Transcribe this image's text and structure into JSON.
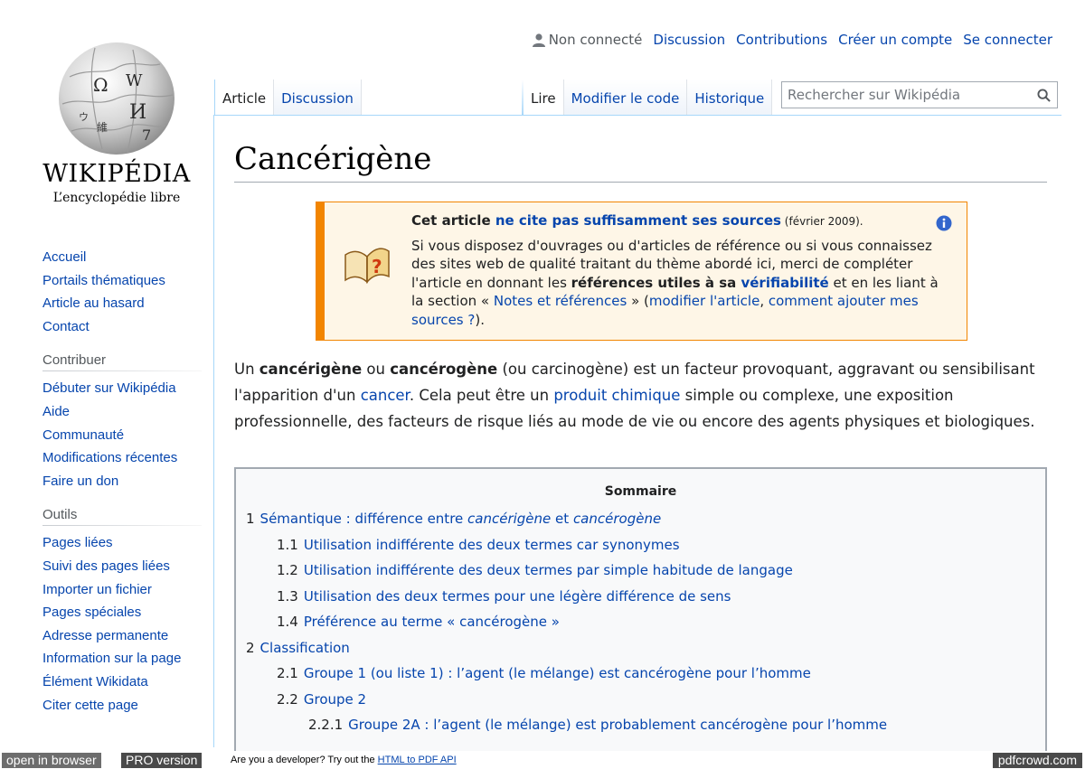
{
  "personal": {
    "status": "Non connecté",
    "links": [
      "Discussion",
      "Contributions",
      "Créer un compte",
      "Se connecter"
    ]
  },
  "logo": {
    "wordmark": "WIKIPÉDIA",
    "tagline": "L’encyclopédie libre",
    "globe_icon": "wikipedia-puzzle-globe"
  },
  "sidebar": {
    "navigation": [
      "Accueil",
      "Portails thématiques",
      "Article au hasard",
      "Contact"
    ],
    "contribuer_heading": "Contribuer",
    "contribuer": [
      "Débuter sur Wikipédia",
      "Aide",
      "Communauté",
      "Modifications récentes",
      "Faire un don"
    ],
    "outils_heading": "Outils",
    "outils": [
      "Pages liées",
      "Suivi des pages liées",
      "Importer un fichier",
      "Pages spéciales",
      "Adresse permanente",
      "Information sur la page",
      "Élément Wikidata",
      "Citer cette page"
    ]
  },
  "tabs": {
    "article": "Article",
    "discussion": "Discussion",
    "lire": "Lire",
    "modifier": "Modifier le code",
    "historique": "Historique"
  },
  "search": {
    "placeholder": "Rechercher sur Wikipédia",
    "icon": "search-icon"
  },
  "page": {
    "title": "Cancérigène"
  },
  "ambox": {
    "headline_pre": "Cet article ",
    "headline_link": "ne cite pas suffisamment ses sources",
    "headline_date": " (février 2009).",
    "body_1": "Si vous disposez d'ouvrages ou d'articles de référence ou si vous connaissez des sites web de qualité traitant du thème abordé ici, merci de compléter l'article en donnant les ",
    "body_bold": "références utiles à sa ",
    "body_bold_link": "vérifiabilité",
    "body_2": " et en les liant à la section « ",
    "body_link_notes": "Notes et références",
    "body_3": " » (",
    "body_link_modifier": "modifier l'article",
    "body_4": ", ",
    "body_link_comment": "comment ajouter mes sources ?",
    "body_5": ").",
    "colors": {
      "border": "#f28500",
      "background": "#fef6e7"
    }
  },
  "lead": {
    "t1": "Un ",
    "b1": "cancérigène",
    "t2": " ou ",
    "b2": "cancérogène",
    "t3": " (ou carcinogène) est un facteur provoquant, aggravant ou sensibilisant l'apparition d'un ",
    "l1": "cancer",
    "t4": ". Cela peut être un ",
    "l2": "produit chimique",
    "t5": " simple ou complexe, une exposition professionnelle, des facteurs de risque liés au mode de vie ou encore des agents physiques et biologiques."
  },
  "toc": {
    "title": "Sommaire",
    "entries": [
      {
        "num": "1",
        "pre": "Sémantique : différence entre ",
        "em1": "cancérigène",
        "mid": " et ",
        "em2": "cancérogène"
      },
      {
        "num": "1.1",
        "text": "Utilisation indifférente des deux termes car synonymes"
      },
      {
        "num": "1.2",
        "text": "Utilisation indifférente des deux termes par simple habitude de langage"
      },
      {
        "num": "1.3",
        "text": "Utilisation des deux termes pour une légère différence de sens"
      },
      {
        "num": "1.4",
        "text": "Préférence au terme « cancérogène »"
      },
      {
        "num": "2",
        "text": "Classification"
      },
      {
        "num": "2.1",
        "text": "Groupe 1 (ou liste 1) : l’agent (le mélange) est cancérogène pour l’homme"
      },
      {
        "num": "2.2",
        "text": "Groupe 2"
      },
      {
        "num": "2.2.1",
        "text": "Groupe 2A : l’agent (le mélange) est probablement cancérogène pour l’homme"
      }
    ]
  },
  "pdfbar": {
    "open_in_browser": "open in browser",
    "pro_version": "PRO version",
    "message": "Are you a developer? Try out the ",
    "api_link": "HTML to PDF API",
    "brand": "pdfcrowd.com"
  },
  "colors": {
    "link": "#0645ad",
    "tab_border": "#a7d7f9",
    "text": "#202122"
  }
}
